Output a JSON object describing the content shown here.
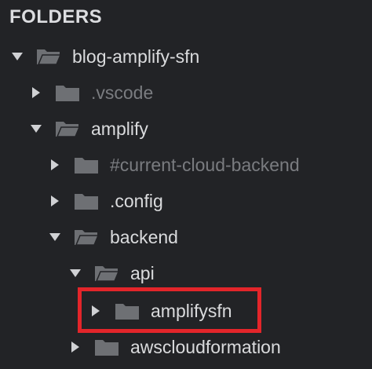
{
  "panel": {
    "title": "FOLDERS"
  },
  "tree": [
    {
      "label": "blog-amplify-sfn",
      "expanded": true,
      "dim": false,
      "icon": "open-folder-icon"
    },
    {
      "label": ".vscode",
      "expanded": false,
      "dim": true,
      "icon": "closed-folder-icon"
    },
    {
      "label": "amplify",
      "expanded": true,
      "dim": false,
      "icon": "open-folder-icon"
    },
    {
      "label": "#current-cloud-backend",
      "expanded": false,
      "dim": true,
      "icon": "closed-folder-icon"
    },
    {
      "label": ".config",
      "expanded": false,
      "dim": false,
      "icon": "closed-folder-icon"
    },
    {
      "label": "backend",
      "expanded": true,
      "dim": false,
      "icon": "open-folder-icon"
    },
    {
      "label": "api",
      "expanded": true,
      "dim": false,
      "icon": "open-folder-icon"
    },
    {
      "label": "amplifysfn",
      "expanded": false,
      "dim": false,
      "icon": "closed-folder-icon",
      "highlighted": true
    },
    {
      "label": "awscloudformation",
      "expanded": false,
      "dim": false,
      "icon": "closed-folder-icon"
    }
  ],
  "colors": {
    "background": "#222326",
    "text": "#dadbdd",
    "dim_text": "#7a7c80",
    "folder_icon": "#6e7074",
    "highlight_border": "#e3252a"
  }
}
